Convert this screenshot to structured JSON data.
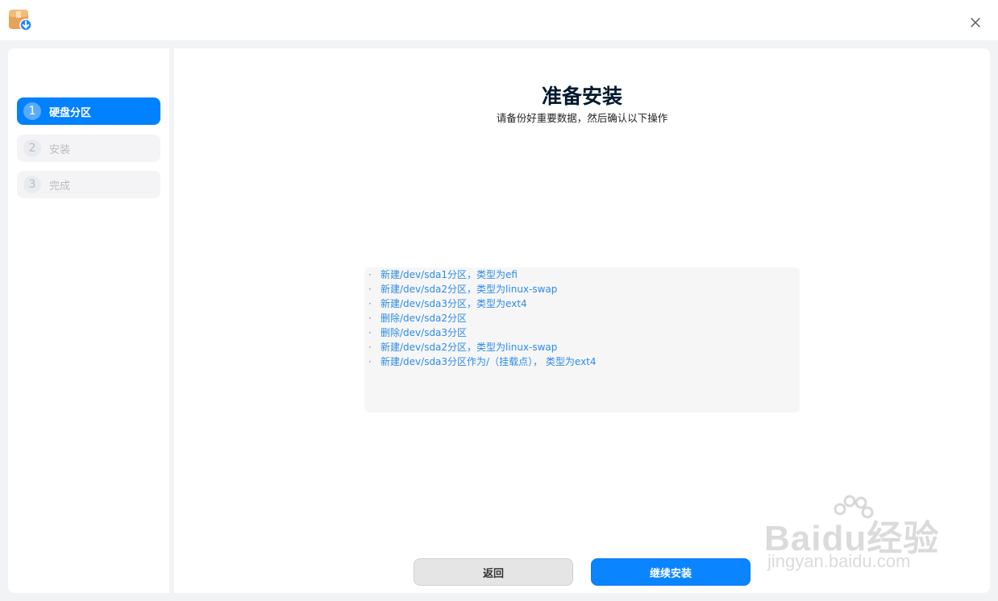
{
  "window": {
    "app_icon": "package-installer-icon",
    "close_icon": "close-icon"
  },
  "sidebar": {
    "steps": [
      {
        "num": "1",
        "label": "硬盘分区",
        "active": true
      },
      {
        "num": "2",
        "label": "安装",
        "active": false
      },
      {
        "num": "3",
        "label": "完成",
        "active": false
      }
    ]
  },
  "main": {
    "title": "准备安装",
    "subtitle": "请备份好重要数据，然后确认以下操作",
    "operations": [
      "新建/dev/sda1分区，类型为efi",
      "新建/dev/sda2分区，类型为linux-swap",
      "新建/dev/sda3分区，类型为ext4",
      "删除/dev/sda2分区",
      "删除/dev/sda3分区",
      "新建/dev/sda2分区，类型为linux-swap",
      "新建/dev/sda3分区作为/（挂载点）， 类型为ext4"
    ],
    "bullet": "·"
  },
  "buttons": {
    "back_label": "返回",
    "continue_label": "继续安装"
  },
  "watermark": {
    "brand": "Baidu经验",
    "url": "jingyan.baidu.com"
  },
  "colors": {
    "accent": "#0081ff",
    "op_text": "#2e8ce8",
    "title": "#001a2e"
  }
}
